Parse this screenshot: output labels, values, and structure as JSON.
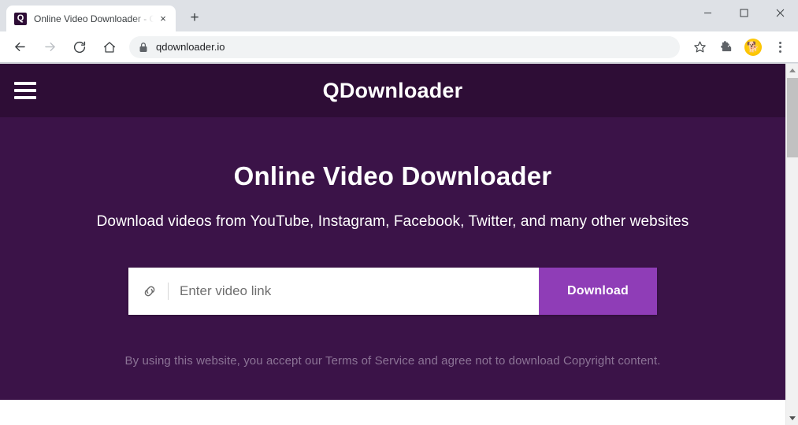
{
  "browser": {
    "tab": {
      "favicon_letter": "Q",
      "title": "Online Video Downloader - Conv",
      "close_label": "×"
    },
    "new_tab_label": "+",
    "window_controls": {
      "minimize": "minimize-button",
      "maximize": "maximize-button",
      "close": "close-button"
    },
    "toolbar": {
      "back": "back-arrow-icon",
      "forward": "forward-arrow-icon",
      "reload": "reload-icon",
      "home": "home-icon",
      "lock": "lock-icon",
      "url": "qdownloader.io",
      "bookmark": "star-icon",
      "extensions": "puzzle-piece-icon",
      "profile": "profile-avatar-icon",
      "profile_glyph": "🐕",
      "menu": "three-dot-menu-icon"
    }
  },
  "site": {
    "menu_icon": "hamburger-menu-icon",
    "brand": "QDownloader",
    "hero": {
      "heading": "Online Video Downloader",
      "subheading": "Download videos from YouTube, Instagram, Facebook, Twitter, and many other websites",
      "input": {
        "icon": "link-chain-icon",
        "placeholder": "Enter video link",
        "value": ""
      },
      "download_button": "Download",
      "terms": "By using this website, you accept our Terms of Service and agree not to download Copyright content."
    }
  },
  "colors": {
    "header_purple": "#2e0d36",
    "hero_purple": "#3b1348",
    "button_purple": "#8f3db7",
    "terms_text": "#8c7496",
    "chrome_bg": "#dee1e6"
  },
  "scrollbar": {
    "up_arrow": "scroll-up-arrow",
    "down_arrow": "scroll-down-arrow"
  }
}
